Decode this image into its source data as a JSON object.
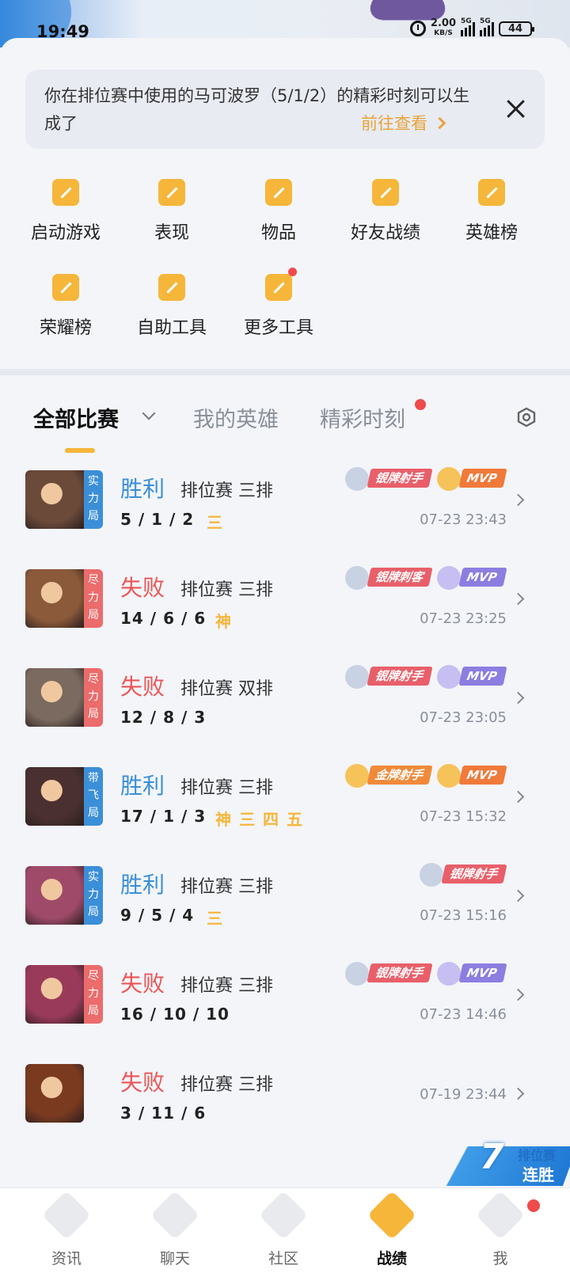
{
  "status_bar": {
    "time": "19:49",
    "net_speed": "2.00",
    "net_unit": "KB/S",
    "signal_1": "5G",
    "signal_2": "5G",
    "battery": "44"
  },
  "notice": {
    "text": "你在排位赛中使用的马可波罗（5/1/2）的精彩时刻可以生成了",
    "link": "前往查看"
  },
  "tools": [
    {
      "label": "启动游戏",
      "icon": "gamepad-icon"
    },
    {
      "label": "表现",
      "icon": "performance-chart-icon"
    },
    {
      "label": "物品",
      "icon": "items-icon"
    },
    {
      "label": "好友战绩",
      "icon": "friend-record-icon"
    },
    {
      "label": "英雄榜",
      "icon": "hero-rank-medal-icon"
    },
    {
      "label": "荣耀榜",
      "icon": "glory-rank-icon"
    },
    {
      "label": "自助工具",
      "icon": "toolbox-icon"
    },
    {
      "label": "更多工具",
      "icon": "more-tools-grid-icon"
    }
  ],
  "tabs": {
    "all": "全部比赛",
    "heroes": "我的英雄",
    "highlights": "精彩时刻"
  },
  "matches": [
    {
      "tag": "实\n力\n局",
      "tag_color": "#3b8fd8",
      "result": "胜利",
      "win": true,
      "mode": "排位赛 三排",
      "kda": "5 / 1 / 2",
      "kda_tags": "三",
      "time": "07-23 23:43",
      "badges": [
        {
          "text": "银牌射手",
          "kind": "silver"
        },
        {
          "text": "MVP",
          "kind": "mvp-gold"
        }
      ]
    },
    {
      "tag": "尽\n力\n局",
      "tag_color": "#ec6b6b",
      "result": "失败",
      "win": false,
      "mode": "排位赛 三排",
      "kda": "14 / 6 / 6",
      "kda_tags": "神",
      "time": "07-23 23:25",
      "badges": [
        {
          "text": "银牌刺客",
          "kind": "silver"
        },
        {
          "text": "MVP",
          "kind": "mvp-purple"
        }
      ]
    },
    {
      "tag": "尽\n力\n局",
      "tag_color": "#ec6b6b",
      "result": "失败",
      "win": false,
      "mode": "排位赛 双排",
      "kda": "12 / 8 / 3",
      "kda_tags": "",
      "time": "07-23 23:05",
      "badges": [
        {
          "text": "银牌射手",
          "kind": "silver"
        },
        {
          "text": "MVP",
          "kind": "mvp-purple"
        }
      ]
    },
    {
      "tag": "带\n飞\n局",
      "tag_color": "#3b8fd8",
      "result": "胜利",
      "win": true,
      "mode": "排位赛 三排",
      "kda": "17 / 1 / 3",
      "kda_tags": "神三四五",
      "time": "07-23 15:32",
      "badges": [
        {
          "text": "金牌射手",
          "kind": "gold"
        },
        {
          "text": "MVP",
          "kind": "mvp-gold"
        }
      ]
    },
    {
      "tag": "实\n力\n局",
      "tag_color": "#3b8fd8",
      "result": "胜利",
      "win": true,
      "mode": "排位赛 三排",
      "kda": "9 / 5 / 4",
      "kda_tags": "三",
      "time": "07-23 15:16",
      "badges": [
        {
          "text": "银牌射手",
          "kind": "silver"
        }
      ]
    },
    {
      "tag": "尽\n力\n局",
      "tag_color": "#ec6b6b",
      "result": "失败",
      "win": false,
      "mode": "排位赛 三排",
      "kda": "16 / 10 / 10",
      "kda_tags": "",
      "time": "07-23 14:46",
      "badges": [
        {
          "text": "银牌射手",
          "kind": "silver"
        },
        {
          "text": "MVP",
          "kind": "mvp-purple"
        }
      ]
    },
    {
      "tag": "",
      "tag_color": "",
      "result": "失败",
      "win": false,
      "mode": "排位赛 三排",
      "kda": "3 / 11 / 6",
      "kda_tags": "",
      "time": "07-19 23:44",
      "badges": []
    }
  ],
  "streak": {
    "number": "7",
    "line1": "排位赛",
    "line2": "连胜"
  },
  "bottom_nav": [
    {
      "label": "资讯",
      "icon": "news-icon",
      "active": false
    },
    {
      "label": "聊天",
      "icon": "chat-icon",
      "active": false
    },
    {
      "label": "社区",
      "icon": "community-icon",
      "active": false
    },
    {
      "label": "战绩",
      "icon": "battle-record-icon",
      "active": true
    },
    {
      "label": "我",
      "icon": "profile-icon",
      "active": false
    }
  ],
  "colors": {
    "accent": "#f5b63a",
    "win": "#3b8fd8",
    "loss": "#ec5555",
    "badge_silver": "#e85f6a",
    "badge_gold": "#f08a3a",
    "mvp_purple": "#8b7ee0"
  }
}
